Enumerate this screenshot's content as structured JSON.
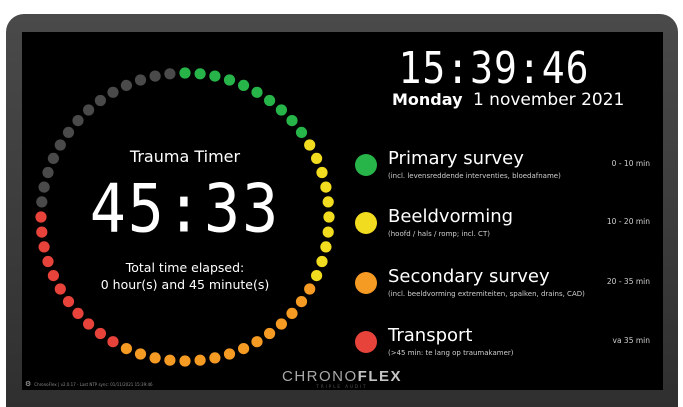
{
  "clock": {
    "time": "15:39:46",
    "weekday": "Monday",
    "date": "1 november 2021"
  },
  "timer": {
    "title": "Trauma Timer",
    "value": "45:33",
    "elapsed_label": "Total time elapsed:",
    "elapsed_value": "0 hour(s) and 45 minute(s)",
    "progress_fraction": 0.76
  },
  "phases": [
    {
      "name": "Primary survey",
      "subtitle": "(incl. levensreddende interventies, bloedafname)",
      "time": "0 - 10 min",
      "color": "#27b54a"
    },
    {
      "name": "Beeldvorming",
      "subtitle": "(hoofd / hals / romp; incl. CT)",
      "time": "10 - 20 min",
      "color": "#f2dc1f"
    },
    {
      "name": "Secondary survey",
      "subtitle": "(incl. beeldvorming extremiteiten, spalken, drains, CAD)",
      "time": "20 - 35 min",
      "color": "#f59a23"
    },
    {
      "name": "Transport",
      "subtitle": "(>45 min: te lang op traumakamer)",
      "time": "va 35 min",
      "color": "#e8433a"
    }
  ],
  "ring_colors": {
    "green": "#27b54a",
    "yellow": "#f2dc1f",
    "orange": "#f59a23",
    "red": "#e8433a",
    "inactive": "#4a4a4a"
  },
  "brand": {
    "name_light": "CHRONO",
    "name_bold": "FLEX",
    "tagline": "TRIPLE AUDIT"
  },
  "footer": {
    "text": "ChronoFlex | v2.0.17 - Last NTP sync: 01/11/2021 15:39:46"
  },
  "icons": {
    "settings": "gear-icon"
  }
}
